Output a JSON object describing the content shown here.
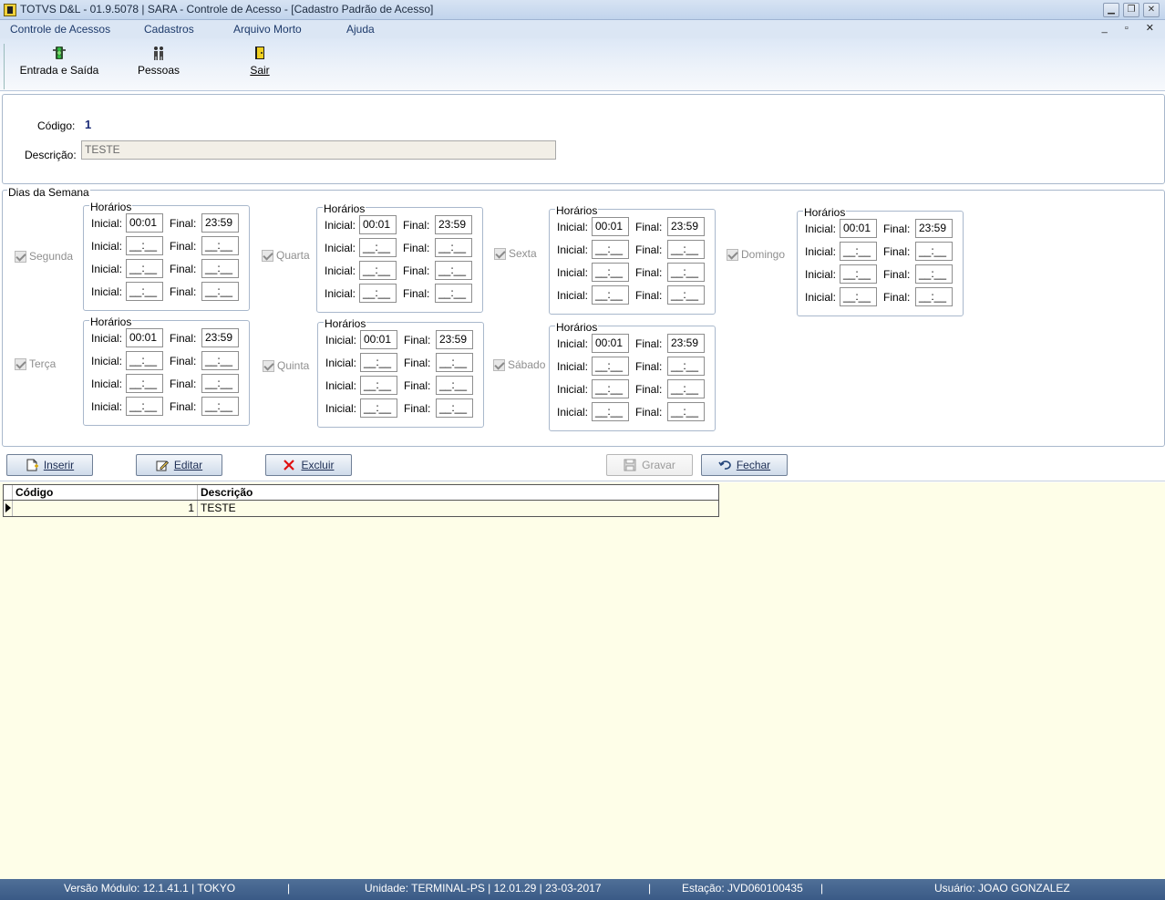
{
  "window": {
    "title": "TOTVS D&L - 01.9.5078 | SARA - Controle de Acesso - [Cadastro Padrão de Acesso]"
  },
  "menu": [
    "Controle de Acessos",
    "Cadastros",
    "Arquivo Morto",
    "Ajuda"
  ],
  "toolbar": {
    "entrada": "Entrada e Saída",
    "pessoas": "Pessoas",
    "sair": "Sair"
  },
  "form": {
    "codigo_label": "Código:",
    "codigo_value": "1",
    "descricao_label": "Descrição:",
    "descricao_value": "TESTE"
  },
  "week": {
    "legend": "Dias da Semana",
    "box_legend": "Horários",
    "inicial_label": "Inicial:",
    "final_label": "Final:",
    "first_inicial": "00:01",
    "first_final": "23:59",
    "empty_time": "__:__",
    "days": [
      "Segunda",
      "Terça",
      "Quarta",
      "Quinta",
      "Sexta",
      "Sábado",
      "Domingo"
    ]
  },
  "actions": {
    "inserir": "Inserir",
    "editar": "Editar",
    "excluir": "Excluir",
    "gravar": "Gravar",
    "fechar": "Fechar"
  },
  "grid": {
    "headers": [
      "Código",
      "Descrição"
    ],
    "rows": [
      {
        "codigo": "1",
        "descricao": "TESTE"
      }
    ]
  },
  "status": {
    "versao": "Versão Módulo:  12.1.41.1  |  TOKYO",
    "unidade": "Unidade: TERMINAL-PS | 12.01.29 | 23-03-2017",
    "estacao": "Estação: JVD060100435",
    "usuario": "Usuário: JOAO GONZALEZ",
    "sep": "|"
  },
  "colors": {
    "titlebar": "#c1d4ec",
    "grid_bg": "#fefee8",
    "statusbar": "#3a5a86"
  }
}
